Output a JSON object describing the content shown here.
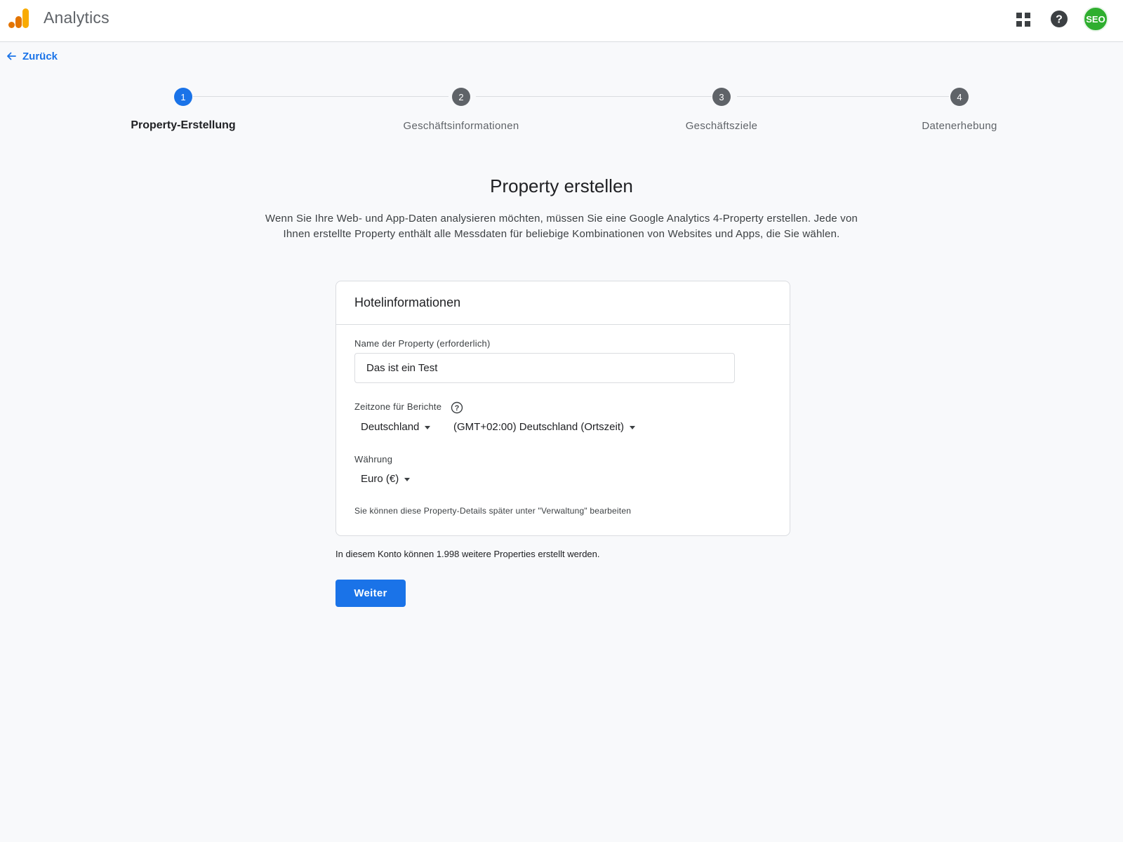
{
  "header": {
    "app_title": "Analytics",
    "logo_icon": "analytics-bars-icon",
    "apps_icon": "apps-grid-icon",
    "help_icon": "help-circle-icon",
    "avatar_text": "SEO",
    "avatar_color": "#2fae2f"
  },
  "back": {
    "label": "Zurück",
    "icon": "arrow-back-icon"
  },
  "stepper": {
    "steps": [
      {
        "number": "1",
        "label": "Property-Erstellung",
        "active": true
      },
      {
        "number": "2",
        "label": "Geschäftsinformationen",
        "active": false
      },
      {
        "number": "3",
        "label": "Geschäftsziele",
        "active": false
      },
      {
        "number": "4",
        "label": "Datenerhebung",
        "active": false
      }
    ],
    "active_color": "#1a73e8",
    "inactive_color": "#5f6368"
  },
  "main": {
    "title": "Property erstellen",
    "intro": "Wenn Sie Ihre Web- und App-Daten analysieren möchten, müssen Sie eine Google Analytics 4-Property erstellen. Jede von Ihnen erstellte Property enthält alle Messdaten für beliebige Kombinationen von Websites und Apps, die Sie wählen."
  },
  "card": {
    "header": "Hotelinformationen",
    "property_name": {
      "label": "Name der Property (erforderlich)",
      "value": "Das ist ein Test"
    },
    "timezone": {
      "label": "Zeitzone für Berichte",
      "country": "Deutschland",
      "zone": "(GMT+02:00) Deutschland (Ortszeit)"
    },
    "currency": {
      "label": "Währung",
      "value": "Euro (€)"
    },
    "note": "Sie können diese Property-Details später unter \"Verwaltung\" bearbeiten"
  },
  "quota_text": "In diesem Konto können 1.998 weitere Properties erstellt werden.",
  "next_button": "Weiter"
}
